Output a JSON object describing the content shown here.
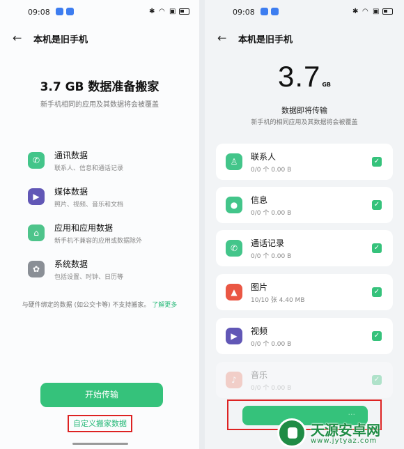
{
  "left": {
    "status": {
      "time": "09:08"
    },
    "title": "本机是旧手机",
    "headline": "3.7 GB 数据准备搬家",
    "subtitle": "新手机相同的应用及其数据将会被覆盖",
    "categories": [
      {
        "name": "通讯数据",
        "desc": "联系人、信息和通话记录",
        "icon": "phone-icon",
        "color": "#43c58a"
      },
      {
        "name": "媒体数据",
        "desc": "照片、视频、音乐和文档",
        "icon": "play-icon",
        "color": "#6157b6"
      },
      {
        "name": "应用和应用数据",
        "desc": "新手机不兼容的应用或数据除外",
        "icon": "android-icon",
        "color": "#4ec48b"
      },
      {
        "name": "系统数据",
        "desc": "包括设置、时钟、日历等",
        "icon": "gear-icon",
        "color": "#8a8f96"
      }
    ],
    "note": "与硬件绑定的数据 (如公交卡等) 不支持搬家。",
    "note_link": "了解更多",
    "start_button": "开始传输",
    "custom_link": "自定义搬家数据"
  },
  "right": {
    "status": {
      "time": "09:08"
    },
    "title": "本机是旧手机",
    "size_value": "3.7",
    "size_unit": "GB",
    "heading": "数据即将传输",
    "subtitle": "新手机的相同应用及其数据将会被覆盖",
    "items": [
      {
        "name": "联系人",
        "meta": "0/0 个   0.00 B",
        "icon": "contact-icon",
        "color": "#43c58a"
      },
      {
        "name": "信息",
        "meta": "0/0 个   0.00 B",
        "icon": "message-icon",
        "color": "#43c58a"
      },
      {
        "name": "通话记录",
        "meta": "0/0 个   0.00 B",
        "icon": "phone-icon",
        "color": "#43c58a"
      },
      {
        "name": "图片",
        "meta": "10/10 张   4.40 MB",
        "icon": "gallery-icon",
        "color": "#ea5744"
      },
      {
        "name": "视频",
        "meta": "0/0 个   0.00 B",
        "icon": "play-icon",
        "color": "#6157b6"
      },
      {
        "name": "音乐",
        "meta": "0/0 个   0.00 B",
        "icon": "music-icon",
        "color": "#f08a75"
      }
    ]
  },
  "watermark": {
    "name": "天源安卓网",
    "url": "www.jytyaz.com"
  }
}
